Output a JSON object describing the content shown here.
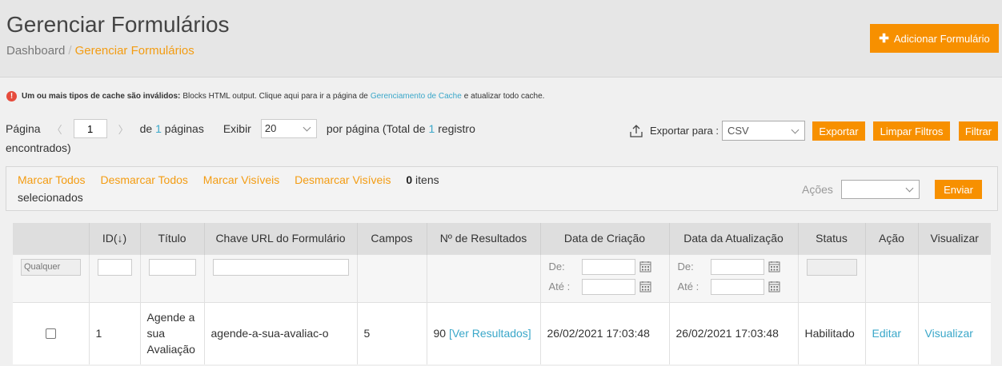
{
  "header": {
    "title": "Gerenciar Formulários",
    "breadcrumb": [
      "Dashboard",
      "Gerenciar Formulários"
    ],
    "breadcrumb_sep": "/",
    "add_button": "Adicionar Formulário"
  },
  "notice": {
    "bold": "Um ou mais tipos de cache são inválidos:",
    "text1": "Blocks HTML output. Clique aqui para ir a página de",
    "link": "Gerenciamento de Cache",
    "text2": "e atualizar todo cache."
  },
  "pager": {
    "pagina_label": "Página",
    "page_value": "1",
    "de": "de",
    "total_pages": "1",
    "paginas": "páginas",
    "exibir": "Exibir",
    "per_page": "20",
    "per_page_text": "por página (Total de",
    "total_records": "1",
    "registro": "registro",
    "encontrados": "encontrados)"
  },
  "export": {
    "label": "Exportar para :",
    "format": "CSV",
    "export_button": "Exportar",
    "clear_button": "Limpar Filtros",
    "filter_button": "Filtrar"
  },
  "massaction": {
    "select_all": "Marcar Todos",
    "unselect_all": "Desmarcar Todos",
    "select_visible": "Marcar Visíveis",
    "unselect_visible": "Desmarcar Visíveis",
    "count": "0",
    "itens": "itens",
    "selecionados": "selecionados",
    "acoes_label": "Ações",
    "submit": "Enviar"
  },
  "grid": {
    "columns": [
      "",
      "ID",
      "Título",
      "Chave URL do Formulário",
      "Campos",
      "Nº de Resultados",
      "Data de Criação",
      "Data da Atualização",
      "Status",
      "Ação",
      "Visualizar"
    ],
    "sort_arrow": "(↓)",
    "filter_any": "Qualquer",
    "date_from": "De:",
    "date_to": "Até :",
    "rows": [
      {
        "id": "1",
        "title": "Agende a sua Avaliação",
        "url_key": "agende-a-sua-avaliac-o",
        "fields": "5",
        "results": "90",
        "results_link": "[Ver Resultados]",
        "created": "26/02/2021 17:03:48",
        "updated": "26/02/2021 17:03:48",
        "status": "Habilitado",
        "action": "Editar",
        "view": "Visualizar"
      }
    ]
  }
}
